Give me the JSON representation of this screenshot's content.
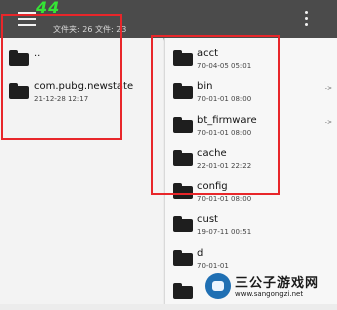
{
  "header": {
    "title_number": "44",
    "counts_text": "文件夹: 26  文件: 23"
  },
  "left_pane": {
    "items": [
      {
        "name": "..",
        "date": ""
      },
      {
        "name": "com.pubg.newstate",
        "date": "21-12-28 12:17"
      }
    ]
  },
  "right_pane": {
    "items": [
      {
        "name": "acct",
        "date": "70-04-05 05:01"
      },
      {
        "name": "bin",
        "date": "70-01-01 08:00"
      },
      {
        "name": "bt_firmware",
        "date": "70-01-01 08:00"
      },
      {
        "name": "cache",
        "date": "22-01-01 22:22"
      },
      {
        "name": "config",
        "date": "70-01-01 08:00"
      },
      {
        "name": "cust",
        "date": "19-07-11 00:51"
      },
      {
        "name": "d",
        "date": "70-01-01"
      },
      {
        "name": "",
        "date": ""
      }
    ],
    "arrow_symbol": "->"
  },
  "watermark": {
    "main": "三公子游戏网",
    "url": "www.sangongzi.net"
  },
  "colors": {
    "highlight": "#e8262a",
    "title_number": "#35e635",
    "topbar": "#4b4b4b"
  }
}
